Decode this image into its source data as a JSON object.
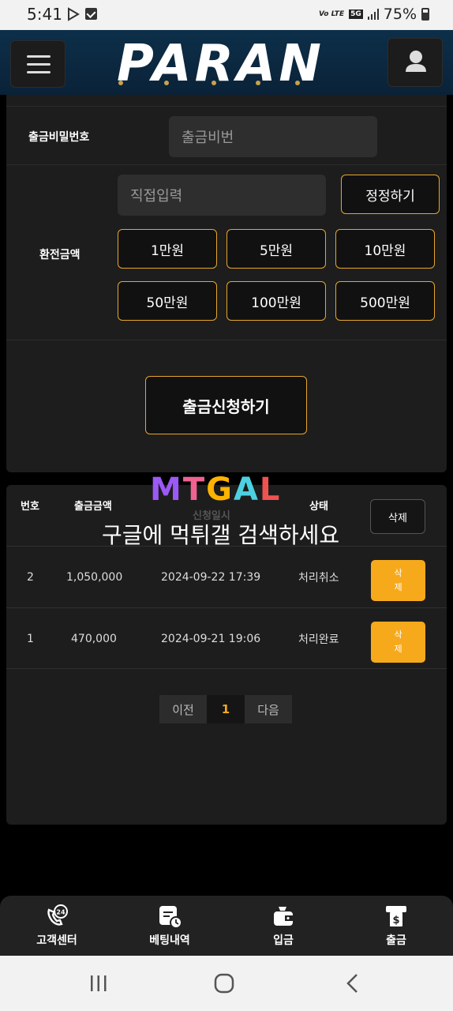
{
  "status_bar": {
    "time": "5:41",
    "lte_label": "Vo LTE",
    "network_label": "5G",
    "battery_label": "75%"
  },
  "header": {
    "logo_text": "PARAN",
    "menu_icon": "hamburger-menu-icon",
    "user_icon": "user-icon"
  },
  "form": {
    "password_label": "출금비밀번호",
    "password_placeholder": "출금비번",
    "amount_label": "환전금액",
    "amount_placeholder": "직접입력",
    "correct_button": "정정하기",
    "amount_buttons": [
      "1만원",
      "5만원",
      "10만원",
      "50만원",
      "100만원",
      "500만원"
    ],
    "submit_button": "출금신청하기"
  },
  "history": {
    "headers": {
      "number": "번호",
      "amount": "출금금액",
      "date": "신청일시",
      "status": "상태"
    },
    "delete_all_label": "삭제",
    "rows": [
      {
        "number": "2",
        "amount": "1,050,000",
        "date": "2024-09-22 17:39",
        "status": "처리취소",
        "delete_line1": "삭",
        "delete_line2": "제"
      },
      {
        "number": "1",
        "amount": "470,000",
        "date": "2024-09-21 19:06",
        "status": "처리완료",
        "delete_line1": "삭",
        "delete_line2": "제"
      }
    ],
    "pagination": {
      "prev": "이전",
      "current": "1",
      "next": "다음"
    }
  },
  "watermark": {
    "logo_letters": [
      "M",
      "T",
      "G",
      "A",
      "L"
    ],
    "text": "구글에 먹튀갤 검색하세요"
  },
  "bottom_nav": {
    "items": [
      {
        "label": "고객센터",
        "icon": "support-24-icon"
      },
      {
        "label": "베팅내역",
        "icon": "betting-history-icon"
      },
      {
        "label": "입금",
        "icon": "wallet-icon"
      },
      {
        "label": "출금",
        "icon": "atm-withdraw-icon"
      }
    ]
  },
  "colors": {
    "accent": "#f7a91c",
    "gold_border": "#e7a62a",
    "header_bg": "#0d2f49",
    "panel_bg": "#1d1d1d"
  }
}
